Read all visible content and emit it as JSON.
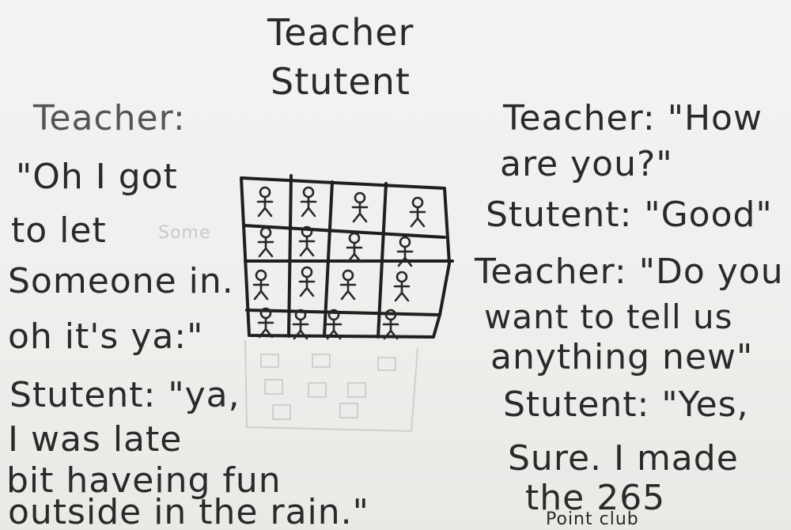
{
  "title": {
    "line1": "Teacher",
    "line2": "Stutent"
  },
  "left_column": {
    "l1": "Teacher:",
    "l2": "\"Oh I got",
    "l3": "to let",
    "l4": "Someone in.",
    "l5": "oh it's ya:\"",
    "l6": "Stutent: \"ya,",
    "l7": "I was late",
    "l8": "bit haveing fun",
    "l9": "outside in the rain.\""
  },
  "ghost_text": "Some",
  "right_column": {
    "r1": "Teacher: \"How",
    "r2": "are you?\"",
    "r3": "Stutent: \"Good\"",
    "r4": "Teacher: \"Do you",
    "r5": "want to tell us",
    "r6": "anything new\"",
    "r7": "Stutent: \"Yes,",
    "r8": "Sure. I made",
    "r9": "the 265",
    "r10": "Point club"
  },
  "grid": {
    "rows": 4,
    "cols": 4,
    "figure_count": 16
  },
  "colors": {
    "paper": "#f0f0ee",
    "ink": "#2a2a2a",
    "ghost": "#cccccc"
  }
}
